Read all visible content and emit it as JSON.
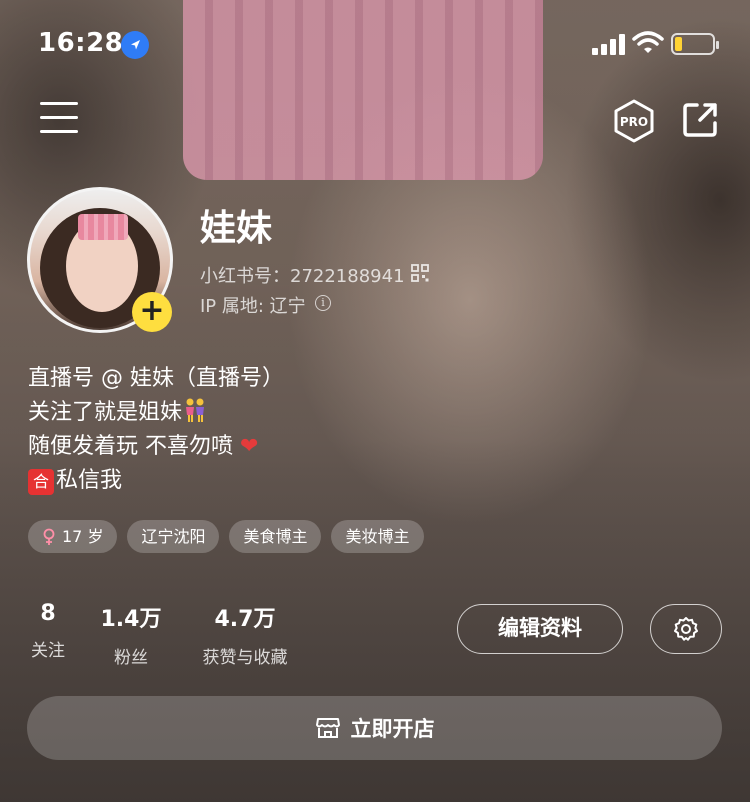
{
  "status_bar": {
    "time": "16:28",
    "battery_level": 0.15
  },
  "nav": {
    "pro_label": "PRO"
  },
  "profile": {
    "name": "娃妹",
    "id_line": "小红书号：2722188941",
    "ip_line": "IP 属地: 辽宁",
    "add_glyph": "+"
  },
  "bio": {
    "line1": "直播号 @ 娃妹（直播号）",
    "line2": "关注了就是姐妹",
    "line3": "随便发着玩 不喜勿喷",
    "line3_emoji": "❤",
    "line4_badge": "合",
    "line4": "私信我"
  },
  "tags": [
    {
      "icon": "female-icon",
      "label": "17 岁"
    },
    {
      "label": "辽宁沈阳"
    },
    {
      "label": "美食博主"
    },
    {
      "label": "美妆博主"
    }
  ],
  "stats": [
    {
      "value": "8",
      "label": "关注"
    },
    {
      "value": "1.4万",
      "label": "粉丝"
    },
    {
      "value": "4.7万",
      "label": "获赞与收藏"
    }
  ],
  "actions": {
    "edit_label": "编辑资料",
    "shop_label": "立即开店"
  },
  "colors": {
    "accent_yellow": "#fede3f",
    "location_blue": "#2f7cf6"
  }
}
